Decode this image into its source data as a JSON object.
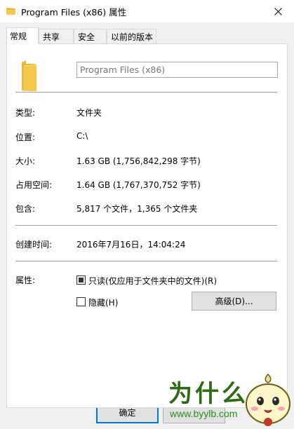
{
  "window": {
    "title": "Program Files (x86) 属性",
    "close_glyph": "✕"
  },
  "tabs": [
    {
      "label": "常规",
      "active": true
    },
    {
      "label": "共享",
      "active": false
    },
    {
      "label": "安全",
      "active": false
    },
    {
      "label": "以前的版本",
      "active": false
    }
  ],
  "general": {
    "name_value": "Program Files (x86)",
    "fields": [
      {
        "label": "类型:",
        "value": "文件夹"
      },
      {
        "label": "位置:",
        "value": "C:\\"
      },
      {
        "label": "大小:",
        "value": "1.63 GB (1,756,842,298 字节)"
      },
      {
        "label": "占用空间:",
        "value": "1.64 GB (1,767,370,752 字节)"
      },
      {
        "label": "包含:",
        "value": "5,817 个文件，1,365 个文件夹"
      }
    ],
    "created": {
      "label": "创建时间:",
      "value": "2016年7月16日，14:04:24"
    },
    "attributes": {
      "label": "属性:",
      "readonly_label": "只读(仅应用于文件夹中的文件)(R)",
      "readonly_state": "indeterminate",
      "hidden_label": "隐藏(H)",
      "hidden_checked": false,
      "advanced_button": "高级(D)..."
    }
  },
  "buttons": {
    "ok": "确定"
  },
  "watermark": {
    "chars": "为什么",
    "url": "www.byylb.com"
  },
  "colors": {
    "folder": "#f8c74d",
    "focus": "#0078d7",
    "watermark_green": "#2e6b12"
  },
  "icons": {
    "title_icon": "folder-icon",
    "big_icon": "folder-icon",
    "close": "close-icon"
  }
}
